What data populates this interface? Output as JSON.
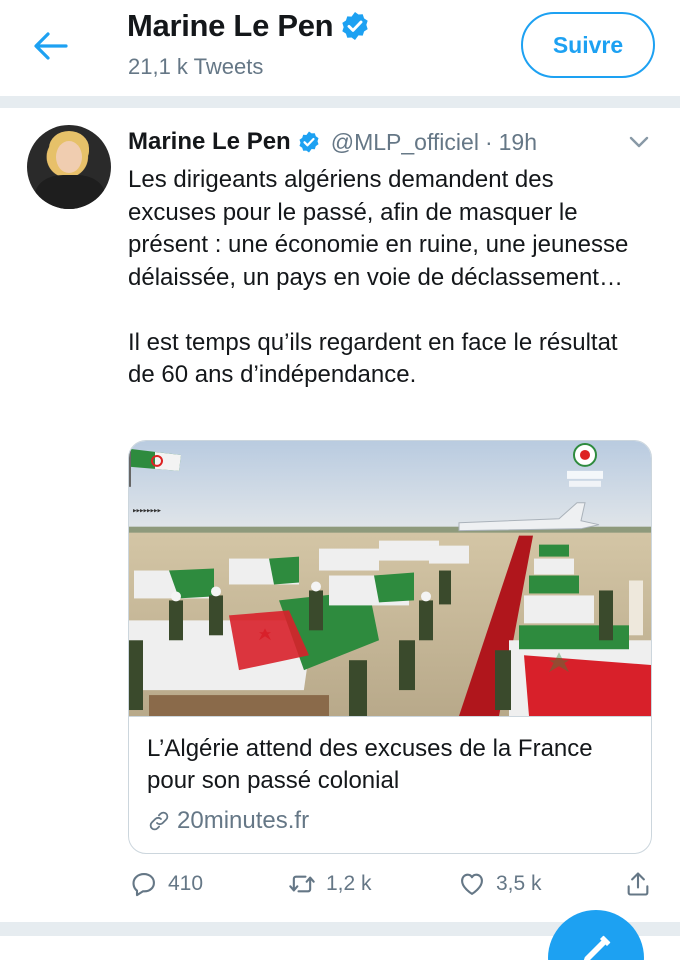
{
  "header": {
    "name": "Marine Le Pen",
    "tweet_count": "21,1 k Tweets",
    "follow_label": "Suivre"
  },
  "tweet": {
    "name": "Marine Le Pen",
    "handle": "@MLP_officiel",
    "separator": "·",
    "time": "19h",
    "text": "Les dirigeants algériens demandent des excuses pour le passé, afin de masquer le présent : une économie en ruine, une jeunesse délaissée, un pays en voie de déclassement…\n\nIl est temps qu’ils regardent en face le résultat de 60 ans d’indépendance."
  },
  "card": {
    "title": "L’Algérie attend des excuses de la France pour son passé colonial",
    "domain": "20minutes.fr"
  },
  "actions": {
    "replies": "410",
    "retweets": "1,2 k",
    "likes": "3,5 k"
  },
  "colors": {
    "accent": "#1da1f2",
    "muted": "#657786",
    "text": "#14171a",
    "divider": "#e6ecf0"
  },
  "icons": {
    "back": "arrow-left-icon",
    "verified": "verified-badge-icon",
    "caret": "chevron-down-icon",
    "link": "link-icon",
    "reply": "reply-icon",
    "retweet": "retweet-icon",
    "like": "heart-icon",
    "share": "share-icon",
    "compose": "compose-icon"
  }
}
